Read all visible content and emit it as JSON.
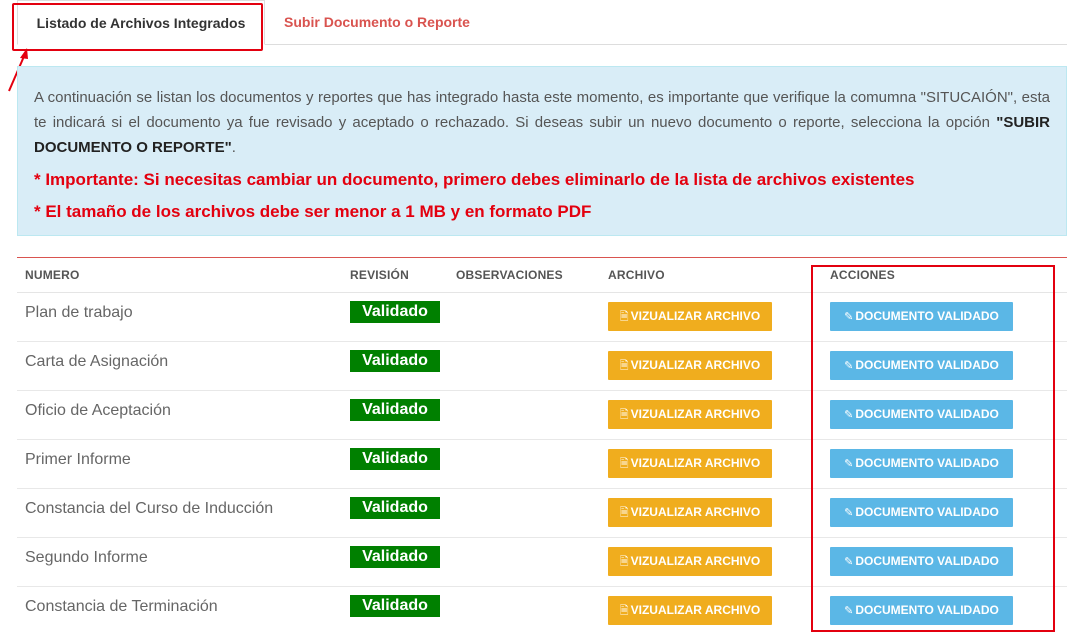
{
  "tabs": {
    "active_label": "Listado de Archivos Integrados",
    "inactive_label": "Subir Documento o Reporte"
  },
  "info": {
    "text_before": "A continuación se listan los documentos y reportes que has integrado hasta este momento, es importante que verifique la comumna \"SITUCAIÓN\", esta te indicará si el documento ya fue revisado y aceptado o rechazado. Si deseas subir un nuevo documento o reporte, selecciona la opción ",
    "option_label": "\"SUBIR DOCUMENTO O REPORTE\"",
    "text_after": ".",
    "warning_1": "* Importante: Si necesitas cambiar un documento, primero debes eliminarlo de la lista de archivos existentes",
    "warning_2": "* El tamaño de los archivos debe ser menor a 1 MB y en formato PDF"
  },
  "table": {
    "headers": {
      "numero": "NUMERO",
      "revision": "REVISIÓN",
      "observaciones": "OBSERVACIONES",
      "archivo": "ARCHIVO",
      "acciones": "ACCIONES"
    },
    "rows": [
      {
        "name": "Plan de trabajo",
        "status": "Validado",
        "observaciones": "",
        "view_label": "VIZUALIZAR ARCHIVO",
        "action_label": "DOCUMENTO VALIDADO"
      },
      {
        "name": "Carta de Asignación",
        "status": "Validado",
        "observaciones": "",
        "view_label": "VIZUALIZAR ARCHIVO",
        "action_label": "DOCUMENTO VALIDADO"
      },
      {
        "name": "Oficio de Aceptación",
        "status": "Validado",
        "observaciones": "",
        "view_label": "VIZUALIZAR ARCHIVO",
        "action_label": "DOCUMENTO VALIDADO"
      },
      {
        "name": "Primer Informe",
        "status": "Validado",
        "observaciones": "",
        "view_label": "VIZUALIZAR ARCHIVO",
        "action_label": "DOCUMENTO VALIDADO"
      },
      {
        "name": "Constancia del Curso de Inducción",
        "status": "Validado",
        "observaciones": "",
        "view_label": "VIZUALIZAR ARCHIVO",
        "action_label": "DOCUMENTO VALIDADO"
      },
      {
        "name": "Segundo Informe",
        "status": "Validado",
        "observaciones": "",
        "view_label": "VIZUALIZAR ARCHIVO",
        "action_label": "DOCUMENTO VALIDADO"
      },
      {
        "name": "Constancia de Terminación",
        "status": "Validado",
        "observaciones": "",
        "view_label": "VIZUALIZAR ARCHIVO",
        "action_label": "DOCUMENTO VALIDADO"
      }
    ]
  },
  "icons": {
    "view": "file-pdf-icon",
    "action": "edit-icon"
  },
  "colors": {
    "validado_badge": "#008000",
    "view_button": "#f0ad1e",
    "action_button": "#5bb7e6",
    "warning_text": "#e3000f",
    "highlight_box": "#e3000f",
    "info_bg": "#d9edf7"
  }
}
